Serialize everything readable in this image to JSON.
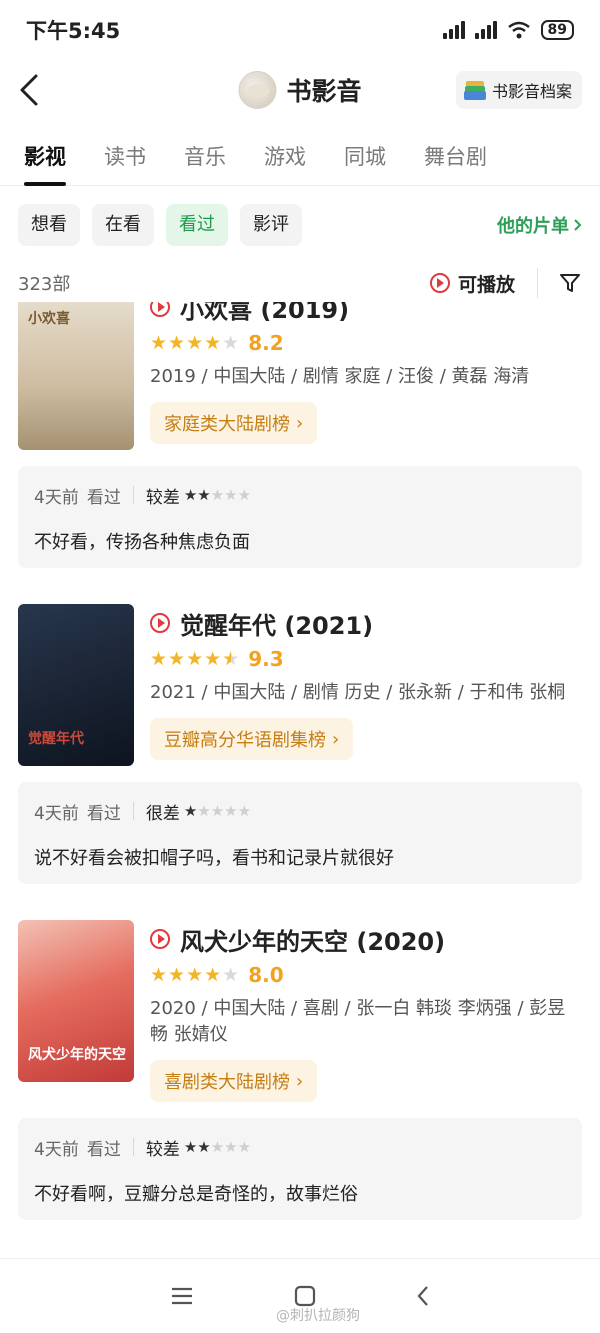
{
  "status_bar": {
    "time": "下午5:45",
    "battery": "89"
  },
  "header": {
    "title": "书影音",
    "archive_label": "书影音档案"
  },
  "tabs": [
    {
      "label": "影视",
      "active": true
    },
    {
      "label": "读书"
    },
    {
      "label": "音乐"
    },
    {
      "label": "游戏"
    },
    {
      "label": "同城"
    },
    {
      "label": "舞台剧"
    }
  ],
  "filters": [
    {
      "label": "想看"
    },
    {
      "label": "在看"
    },
    {
      "label": "看过",
      "active": true
    },
    {
      "label": "影评"
    }
  ],
  "list_link": "他的片单",
  "count": "323部",
  "playable_label": "可播放",
  "items": [
    {
      "title": "小欢喜 (2019)",
      "poster_text": "小欢喜",
      "rating_stars": 4,
      "score": "8.2",
      "meta": "2019 / 中国大陆 / 剧情 家庭 / 汪俊 / 黄磊 海清",
      "rank": "家庭类大陆剧榜",
      "review": {
        "time": "4天前",
        "status": "看过",
        "level": "较差",
        "stars": 2,
        "text": "不好看，传扬各种焦虑负面"
      }
    },
    {
      "title": "觉醒年代 (2021)",
      "poster_text": "觉醒年代",
      "rating_stars": 4.5,
      "score": "9.3",
      "meta": "2021 / 中国大陆 / 剧情 历史 / 张永新 / 于和伟 张桐",
      "rank": "豆瓣高分华语剧集榜",
      "review": {
        "time": "4天前",
        "status": "看过",
        "level": "很差",
        "stars": 1,
        "text": "说不好看会被扣帽子吗，看书和记录片就很好"
      }
    },
    {
      "title": "风犬少年的天空 (2020)",
      "poster_text": "风犬少年的天空",
      "rating_stars": 4,
      "score": "8.0",
      "meta": "2020 / 中国大陆 / 喜剧 / 张一白 韩琰 李炳强 / 彭昱畅 张婧仪",
      "rank": "喜剧类大陆剧榜",
      "review": {
        "time": "4天前",
        "status": "看过",
        "level": "较差",
        "stars": 2,
        "text": "不好看啊，豆瓣分总是奇怪的，故事烂俗"
      }
    }
  ],
  "watermark": "@刺扒拉颜狗",
  "colors": {
    "accent_green": "#2e9f58",
    "star": "#f3b527",
    "play_red": "#e0393e",
    "rank_orange": "#c57e12"
  }
}
